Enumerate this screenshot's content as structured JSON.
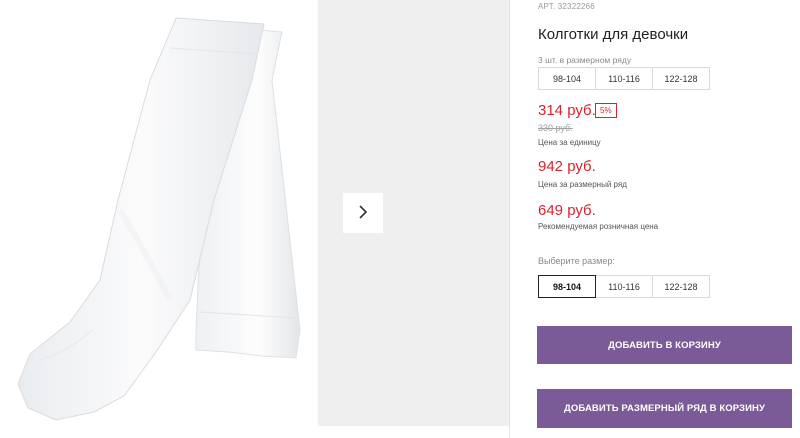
{
  "product": {
    "sku_label": "АРТ. 32322266",
    "title": "Колготки для девочки",
    "pack_label": "3 шт. в размерном ряду",
    "pack_sizes": [
      "98-104",
      "110-116",
      "122-128"
    ],
    "unit_price": "314 руб.",
    "discount_badge": "5%",
    "old_price": "330 руб.",
    "unit_price_caption": "Цена за единицу",
    "pack_price": "942 руб.",
    "pack_price_caption": "Цена за размерный ряд",
    "retail_price": "649 руб.",
    "retail_price_caption": "Рекомендуемая розничная цена",
    "choose_size_label": "Выберите размер:",
    "size_options": [
      "98-104",
      "110-116",
      "122-128"
    ],
    "selected_size": "98-104"
  },
  "actions": {
    "add_to_cart": "ДОБАВИТЬ В КОРЗИНУ",
    "add_pack_to_cart": "ДОБАВИТЬ РАЗМЕРНЫЙ РЯД В КОРЗИНУ"
  },
  "icons": {
    "next": "chevron-right-icon"
  },
  "colors": {
    "price": "#d9232d",
    "button": "#7a5a97",
    "gallery_bg": "#efefef"
  }
}
